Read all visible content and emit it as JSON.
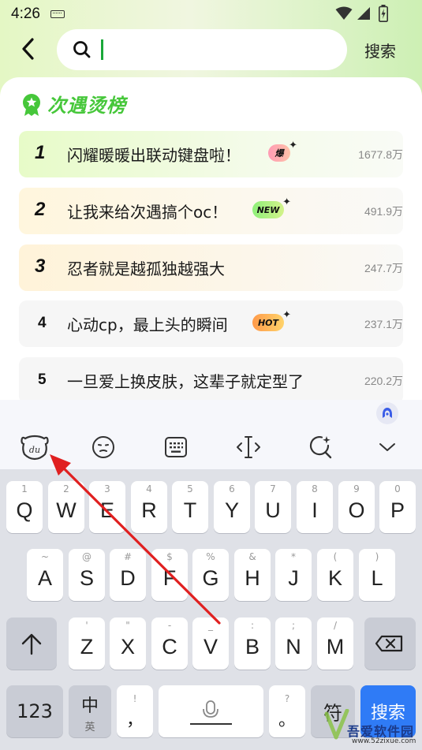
{
  "status_bar": {
    "time": "4:26"
  },
  "search": {
    "button_label": "搜索",
    "value": ""
  },
  "ranking": {
    "title": "次遇烫榜",
    "items": [
      {
        "rank": "1",
        "text": "闪耀暖暖出联动键盘啦！",
        "badge": "爆",
        "count": "1677.8万"
      },
      {
        "rank": "2",
        "text": "让我来给次遇搞个oc！",
        "badge": "NEW",
        "count": "491.9万"
      },
      {
        "rank": "3",
        "text": "忍者就是越孤独越强大",
        "badge": "",
        "count": "247.7万"
      },
      {
        "rank": "4",
        "text": "心动cp，最上头的瞬间",
        "badge": "HOT",
        "count": "237.1万"
      },
      {
        "rank": "5",
        "text": "一旦爱上换皮肤，这辈子就定型了",
        "badge": "",
        "count": "220.2万"
      }
    ]
  },
  "keyboard": {
    "row1": [
      {
        "hint": "1",
        "key": "Q"
      },
      {
        "hint": "2",
        "key": "W"
      },
      {
        "hint": "3",
        "key": "E"
      },
      {
        "hint": "4",
        "key": "R"
      },
      {
        "hint": "5",
        "key": "T"
      },
      {
        "hint": "6",
        "key": "Y"
      },
      {
        "hint": "7",
        "key": "U"
      },
      {
        "hint": "8",
        "key": "I"
      },
      {
        "hint": "9",
        "key": "O"
      },
      {
        "hint": "0",
        "key": "P"
      }
    ],
    "row2": [
      {
        "hint": "~",
        "key": "A"
      },
      {
        "hint": "@",
        "key": "S"
      },
      {
        "hint": "#",
        "key": "D"
      },
      {
        "hint": "$",
        "key": "F"
      },
      {
        "hint": "%",
        "key": "G"
      },
      {
        "hint": "&",
        "key": "H"
      },
      {
        "hint": "*",
        "key": "J"
      },
      {
        "hint": "(",
        "key": "K"
      },
      {
        "hint": ")",
        "key": "L"
      }
    ],
    "row3": [
      {
        "hint": "'",
        "key": "Z"
      },
      {
        "hint": "\"",
        "key": "X"
      },
      {
        "hint": "-",
        "key": "C"
      },
      {
        "hint": "_",
        "key": "V"
      },
      {
        "hint": ":",
        "key": "B"
      },
      {
        "hint": ";",
        "key": "N"
      },
      {
        "hint": "/",
        "key": "M"
      }
    ],
    "num_key": "123",
    "lang_key": "中",
    "lang_sub": "英",
    "comma_hint": "!",
    "comma_key": "，",
    "period_hint": "?",
    "period_key": "。",
    "symbol_key": "符",
    "search_key": "搜索"
  },
  "watermark": {
    "text": "吾爱软件园",
    "url": "www.52zixue.com"
  },
  "colors": {
    "accent_green": "#46c73a",
    "annotation_red": "#e02020",
    "search_key_blue": "#2f7bf6"
  }
}
